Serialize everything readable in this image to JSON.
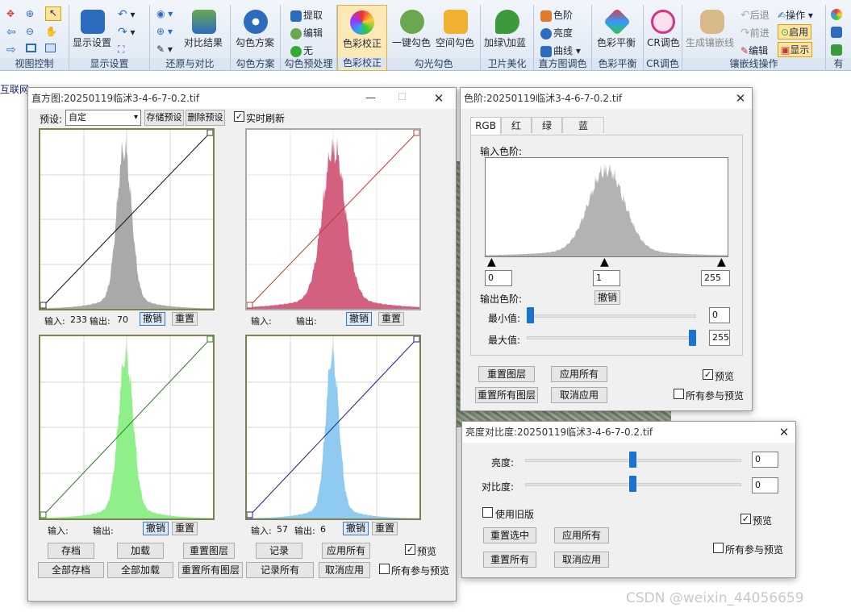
{
  "ribbon": {
    "groups": [
      {
        "title": "视图控制"
      },
      {
        "title": "显示设置"
      },
      {
        "title": "还原与对比"
      },
      {
        "title": "勾色方案"
      },
      {
        "title": "勾色预处理"
      },
      {
        "title": "色彩校正"
      },
      {
        "title": "勾光勾色"
      },
      {
        "title": "卫片美化"
      },
      {
        "title": "直方图调色"
      },
      {
        "title": "色彩平衡"
      },
      {
        "title": "CR调色"
      },
      {
        "title": "镶嵌线操作"
      },
      {
        "title": "有"
      }
    ],
    "buttons": {
      "display_settings": "显示设置",
      "compare_result": "对比结果",
      "color_scheme": "勾色方案",
      "extract": "提取",
      "edit": "编辑",
      "none": "无",
      "color_correction": "色彩校正",
      "one_key": "一键勾色",
      "space_color": "空间勾色",
      "green_blue": "加绿\\加蓝",
      "levels": "色阶",
      "brightness": "亮度",
      "curve": "曲线",
      "color_balance": "色彩平衡",
      "cr_adjust": "CR调色",
      "gen_mosaic": "生成镶嵌线",
      "back": "后退",
      "forward": "前进",
      "mosaic_edit": "编辑",
      "operate": "操作",
      "enable": "启用",
      "show": "显示"
    }
  },
  "workspace": {
    "side_text": "互联网"
  },
  "histogram": {
    "title": "直方图:20250119临沭3-4-6-7-0.2.tif",
    "preset_label": "预设:",
    "preset_value": "自定",
    "save_preset": "存储预设",
    "delete_preset": "删除预设",
    "realtime": "实时刷新",
    "panels": [
      {
        "input_label": "输入:",
        "input_value": "233",
        "output_label": "输出:",
        "output_value": "70",
        "undo": "撤销",
        "reset": "重置"
      },
      {
        "input_label": "输入:",
        "input_value": "",
        "output_label": "输出:",
        "output_value": "",
        "undo": "撤销",
        "reset": "重置"
      },
      {
        "input_label": "输入:",
        "input_value": "",
        "output_label": "输出:",
        "output_value": "",
        "undo": "撤销",
        "reset": "重置"
      },
      {
        "input_label": "输入:",
        "input_value": "57",
        "output_label": "输出:",
        "output_value": "6",
        "undo": "撤销",
        "reset": "重置"
      }
    ],
    "buttons": {
      "save": "存档",
      "load": "加载",
      "reset_layer": "重置图层",
      "record": "记录",
      "apply_all": "应用所有",
      "save_all": "全部存档",
      "load_all": "全部加载",
      "reset_all_layers": "重置所有图层",
      "record_all": "记录所有",
      "cancel_apply": "取消应用"
    },
    "preview": "预览",
    "all_preview": "所有参与预览"
  },
  "levels": {
    "title": "色阶:20250119临沭3-4-6-7-0.2.tif",
    "tabs": [
      "RGB",
      "红",
      "绿",
      "蓝"
    ],
    "input_label": "输入色阶:",
    "input_values": [
      "0",
      "1",
      "255"
    ],
    "output_label": "输出色阶:",
    "undo": "撤销",
    "min_label": "最小值:",
    "min_value": "0",
    "max_label": "最大值:",
    "max_value": "255",
    "min_level": 0,
    "max_level": 1,
    "buttons": {
      "reset_layer": "重置图层",
      "apply_all": "应用所有",
      "reset_all_layers": "重置所有图层",
      "cancel_apply": "取消应用"
    },
    "preview": "预览",
    "all_preview": "所有参与预览"
  },
  "brightness": {
    "title": "亮度对比度:20250119临沭3-4-6-7-0.2.tif",
    "brightness_label": "亮度:",
    "brightness_value": "0",
    "contrast_label": "对比度:",
    "contrast_value": "0",
    "legacy": "使用旧版",
    "preview": "预览",
    "buttons": {
      "reset_selected": "重置选中",
      "apply_all": "应用所有",
      "reset_all": "重置所有",
      "cancel_apply": "取消应用"
    },
    "all_preview": "所有参与预览"
  },
  "watermark": "CSDN @weixin_44056659",
  "colors": {
    "gray": "#a9a9a9",
    "red": "#d4607f",
    "green": "#8ff08a",
    "blue": "#8fcbf0"
  }
}
